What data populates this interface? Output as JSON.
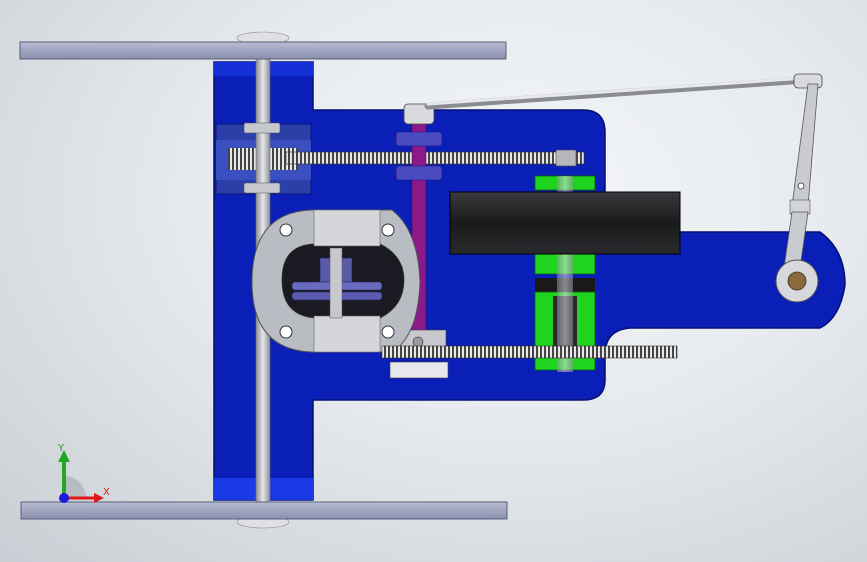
{
  "viewport": {
    "background_top": "#f4f6f8",
    "background_bottom": "#c9ced4"
  },
  "colors": {
    "frame_blue": "#0a1eb8",
    "frame_blue_dark": "#06128a",
    "rail_gray": "#9a9fb8",
    "shaft_gray": "#c4c6cc",
    "gear_gray": "#9a9a9a",
    "bearing_gray": "#b9bcc2",
    "wheel_black": "#1c1c1e",
    "rod_purple": "#8a1a8a",
    "spring_green": "#1fd41f",
    "slider_violet": "#5a5aa8"
  },
  "model": {
    "components": [
      "top-rail",
      "bottom-rail",
      "vertical-shaft",
      "base-plate",
      "upper-gear-rack",
      "lower-gear-rack",
      "housing-ring",
      "black-wheel",
      "green-spring-assembly",
      "linkage-rod",
      "crank-arm"
    ]
  },
  "triad": {
    "x_label": "X",
    "y_label": "Y",
    "x_color": "#e01818",
    "y_color": "#22a822",
    "z_color": "#1a1ad8"
  }
}
